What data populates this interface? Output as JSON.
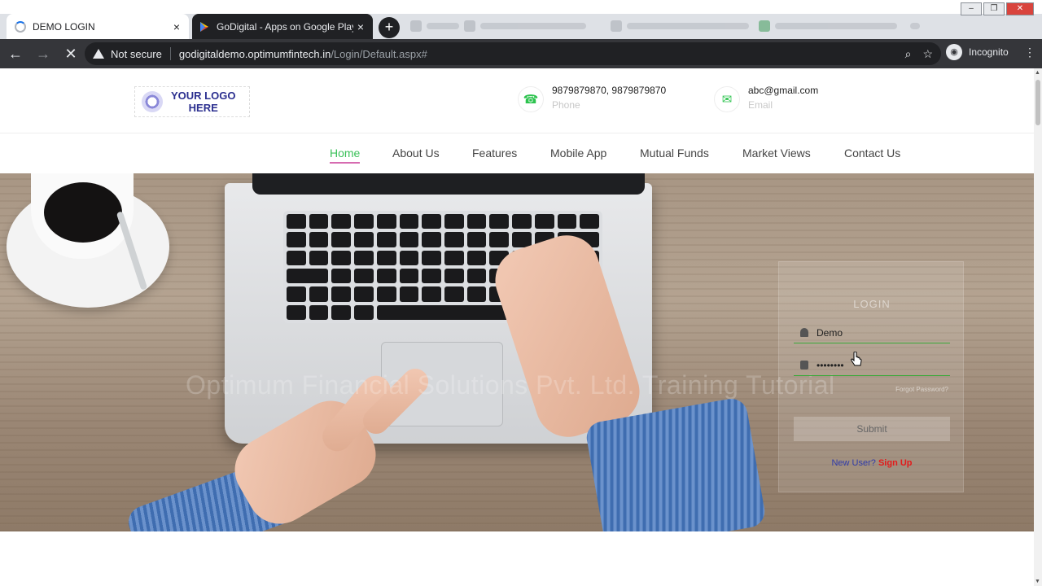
{
  "browser": {
    "tabs": [
      {
        "title": "DEMO LOGIN",
        "close": "×"
      },
      {
        "title": "GoDigital - Apps on Google Play",
        "close": "×"
      }
    ],
    "new_tab": "+",
    "security_label": "Not secure",
    "url_host": "godigitaldemo.optimumfintech.in",
    "url_path": "/Login/Default.aspx#",
    "incognito_label": "Incognito",
    "nav": {
      "back": "←",
      "forward": "→",
      "stop": "✕"
    },
    "icons": {
      "zoom": "⌕",
      "star": "☆",
      "menu": "⋮"
    },
    "window_controls": {
      "minimize": "–",
      "restore": "❐",
      "close": "✕"
    }
  },
  "header": {
    "logo_line1": "YOUR LOGO",
    "logo_line2": "HERE",
    "phone": {
      "value": "9879879870, 9879879870",
      "label": "Phone",
      "icon": "☎"
    },
    "email": {
      "value": "abc@gmail.com",
      "label": "Email",
      "icon": "✉"
    }
  },
  "nav": {
    "items": [
      {
        "label": "Home",
        "active": true
      },
      {
        "label": "About Us"
      },
      {
        "label": "Features"
      },
      {
        "label": "Mobile App"
      },
      {
        "label": "Mutual Funds"
      },
      {
        "label": "Market Views"
      },
      {
        "label": "Contact Us"
      }
    ]
  },
  "hero": {
    "watermark": "Optimum Financial Solutions Pvt. Ltd. Training Tutorial"
  },
  "login": {
    "title": "LOGIN",
    "username": "Demo",
    "password": "••••••••",
    "forgot": "Forgot Password?",
    "submit": "Submit",
    "new_user": "New User?",
    "sign_up": "Sign Up"
  },
  "colors": {
    "accent_green": "#3cc15a",
    "active_underline": "#d66bb0",
    "signup_red": "#e21b1b",
    "chrome_dark": "#35363a"
  }
}
